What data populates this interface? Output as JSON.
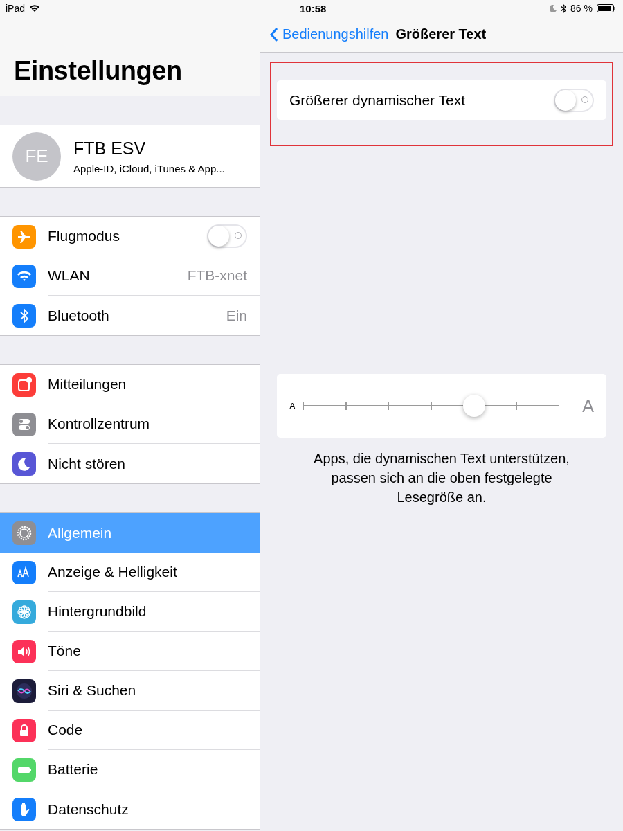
{
  "status_bar": {
    "device": "iPad",
    "time": "10:58",
    "battery": "86 %"
  },
  "sidebar": {
    "title": "Einstellungen",
    "profile": {
      "initials": "FE",
      "name": "FTB ESV",
      "subtitle": "Apple-ID, iCloud, iTunes & App..."
    },
    "groups": [
      [
        {
          "label": "Flugmodus",
          "kind": "toggle",
          "on": false,
          "selected": false,
          "color": "#ff9500"
        },
        {
          "label": "WLAN",
          "kind": "value",
          "value": "FTB-xnet",
          "selected": false,
          "color": "#147efb"
        },
        {
          "label": "Bluetooth",
          "kind": "value",
          "value": "Ein",
          "selected": false,
          "color": "#147efb"
        }
      ],
      [
        {
          "label": "Mitteilungen",
          "kind": "link",
          "selected": false,
          "color": "#fc3d39"
        },
        {
          "label": "Kontrollzentrum",
          "kind": "link",
          "selected": false,
          "color": "#8e8e93"
        },
        {
          "label": "Nicht stören",
          "kind": "link",
          "selected": false,
          "color": "#5856d6"
        }
      ],
      [
        {
          "label": "Allgemein",
          "kind": "link",
          "selected": true,
          "color": "#8e8e93"
        },
        {
          "label": "Anzeige & Helligkeit",
          "kind": "link",
          "selected": false,
          "color": "#147efb"
        },
        {
          "label": "Hintergrundbild",
          "kind": "link",
          "selected": false,
          "color": "#35aadc"
        },
        {
          "label": "Töne",
          "kind": "link",
          "selected": false,
          "color": "#fc3158"
        },
        {
          "label": "Siri & Suchen",
          "kind": "link",
          "selected": false,
          "color": "#1c1c3a"
        },
        {
          "label": "Code",
          "kind": "link",
          "selected": false,
          "color": "#fc3158"
        },
        {
          "label": "Batterie",
          "kind": "link",
          "selected": false,
          "color": "#53d769"
        },
        {
          "label": "Datenschutz",
          "kind": "link",
          "selected": false,
          "color": "#147efb"
        }
      ]
    ]
  },
  "detail": {
    "back": "Bedienungshilfen",
    "title": "Größerer Text",
    "larger_text": {
      "label": "Größerer dynamischer Text",
      "on": false
    },
    "slider": {
      "small_label": "A",
      "large_label": "A",
      "level": 0.667
    },
    "caption": "Apps, die dynamischen Text unterstützen, passen sich an die oben festgelegte Lesegröße an."
  }
}
